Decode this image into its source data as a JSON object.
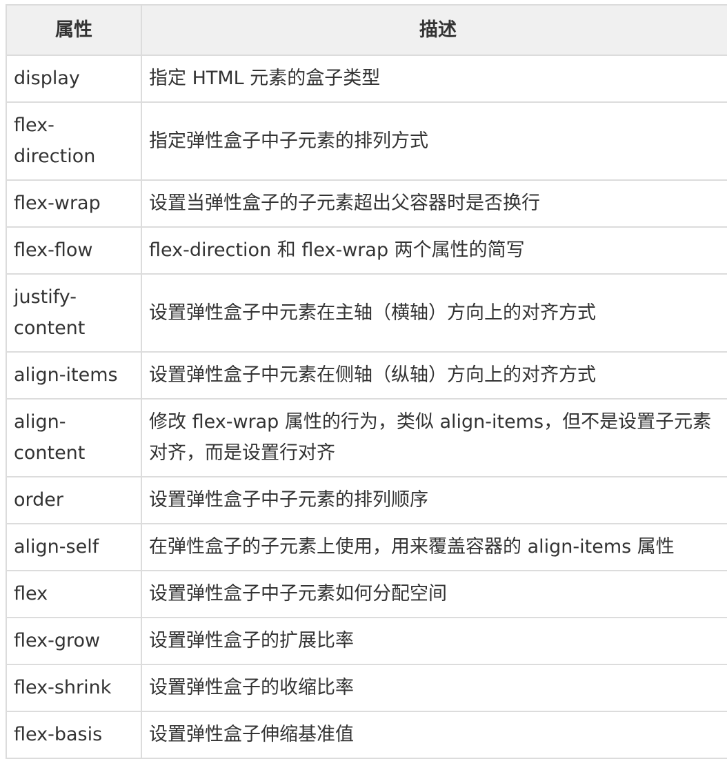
{
  "table": {
    "headers": [
      "属性",
      "描述"
    ],
    "rows": [
      {
        "property": "display",
        "description": "指定 HTML 元素的盒子类型"
      },
      {
        "property": "flex-direction",
        "description": "指定弹性盒子中子元素的排列方式"
      },
      {
        "property": "flex-wrap",
        "description": "设置当弹性盒子的子元素超出父容器时是否换行"
      },
      {
        "property": "flex-flow",
        "description": "flex-direction 和 flex-wrap 两个属性的简写"
      },
      {
        "property": "justify-content",
        "description": "设置弹性盒子中元素在主轴（横轴）方向上的对齐方式"
      },
      {
        "property": "align-items",
        "description": "设置弹性盒子中元素在侧轴（纵轴）方向上的对齐方式"
      },
      {
        "property": "align-content",
        "description": "修改 flex-wrap 属性的行为，类似 align-items，但不是设置子元素对齐，而是设置行对齐"
      },
      {
        "property": "order",
        "description": "设置弹性盒子中子元素的排列顺序"
      },
      {
        "property": "align-self",
        "description": "在弹性盒子的子元素上使用，用来覆盖容器的 align-items 属性"
      },
      {
        "property": "flex",
        "description": "设置弹性盒子中子元素如何分配空间"
      },
      {
        "property": "flex-grow",
        "description": "设置弹性盒子的扩展比率"
      },
      {
        "property": "flex-shrink",
        "description": "设置弹性盒子的收缩比率"
      },
      {
        "property": "flex-basis",
        "description": "设置弹性盒子伸缩基准值"
      }
    ]
  }
}
